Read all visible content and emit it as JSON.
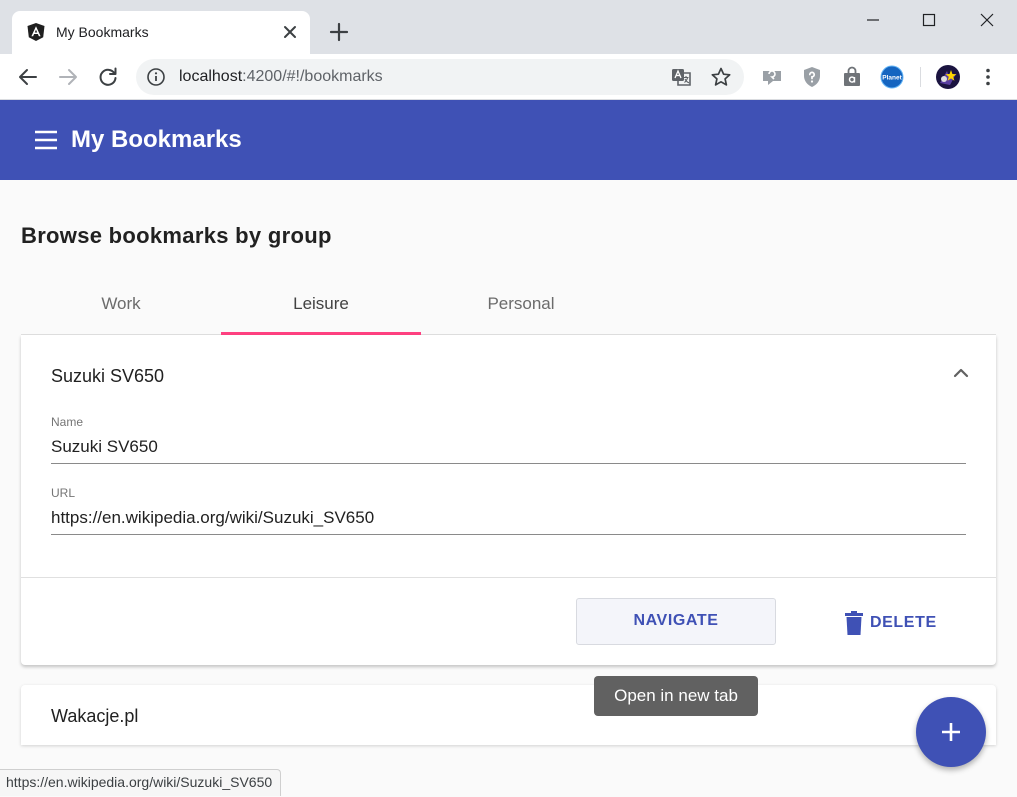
{
  "browser": {
    "tab_title": "My Bookmarks",
    "url_host": "localhost",
    "url_rest": ":4200/#!/bookmarks",
    "status_url": "https://en.wikipedia.org/wiki/Suzuki_SV650",
    "icons": [
      "angular-favicon-icon",
      "close-icon",
      "plus-icon",
      "minimize-icon",
      "maximize-icon",
      "window-close-icon",
      "back-arrow-icon",
      "forward-arrow-icon",
      "reload-icon",
      "info-icon",
      "translate-icon",
      "star-icon",
      "extension-icon",
      "shield-icon",
      "shopping-bag-icon",
      "planet-icon",
      "profile-avatar-icon",
      "more-vert-icon"
    ]
  },
  "app": {
    "title": "My Bookmarks",
    "heading": "Browse bookmarks by group",
    "tabs": [
      {
        "label": "Work",
        "active": false
      },
      {
        "label": "Leisure",
        "active": true
      },
      {
        "label": "Personal",
        "active": false
      }
    ],
    "bookmark": {
      "title": "Suzuki SV650",
      "name_label": "Name",
      "name_value": "Suzuki SV650",
      "url_label": "URL",
      "url_value": "https://en.wikipedia.org/wiki/Suzuki_SV650",
      "navigate_label": "NAVIGATE",
      "delete_label": "DELETE"
    },
    "next_bookmark_title": "Wakacje.pl",
    "tooltip": "Open in new tab"
  },
  "colors": {
    "primary": "#3f51b5",
    "accent": "#ff4081",
    "tooltip_bg": "#616161",
    "chrome_tabstrip": "#dee1e6"
  }
}
